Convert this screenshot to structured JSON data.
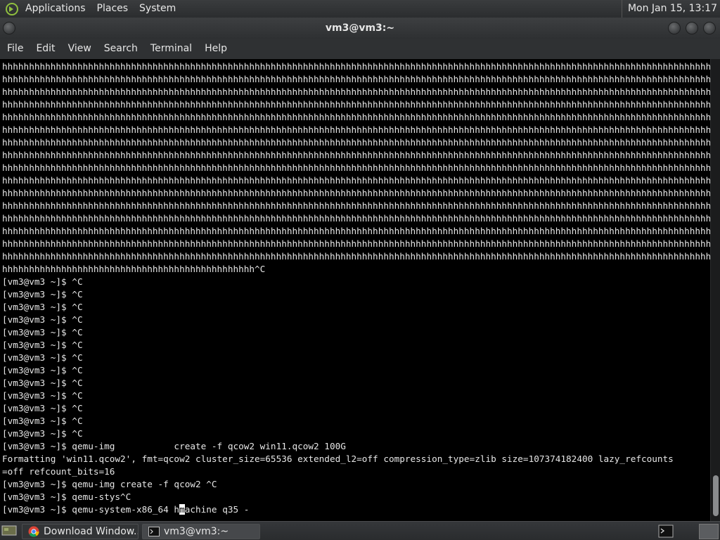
{
  "top_panel": {
    "menus": [
      "Applications",
      "Places",
      "System"
    ],
    "clock": "Mon Jan 15, 13:17"
  },
  "window": {
    "title": "vm3@vm3:~"
  },
  "menubar": [
    "File",
    "Edit",
    "View",
    "Search",
    "Terminal",
    "Help"
  ],
  "terminal": {
    "lines": [
      "hhhhhhhhhhhhhhhhhhhhhhhhhhhhhhhhhhhhhhhhhhhhhhhhhhhhhhhhhhhhhhhhhhhhhhhhhhhhhhhhhhhhhhhhhhhhhhhhhhhhhhhhhhhhhhhhhhhhhhhhhhhhhhhhhhhhhhhhhhhh",
      "hhhhhhhhhhhhhhhhhhhhhhhhhhhhhhhhhhhhhhhhhhhhhhhhhhhhhhhhhhhhhhhhhhhhhhhhhhhhhhhhhhhhhhhhhhhhhhhhhhhhhhhhhhhhhhhhhhhhhhhhhhhhhhhhhhhhhhhhhhhh",
      "hhhhhhhhhhhhhhhhhhhhhhhhhhhhhhhhhhhhhhhhhhhhhhhhhhhhhhhhhhhhhhhhhhhhhhhhhhhhhhhhhhhhhhhhhhhhhhhhhhhhhhhhhhhhhhhhhhhhhhhhhhhhhhhhhhhhhhhhhhhh",
      "hhhhhhhhhhhhhhhhhhhhhhhhhhhhhhhhhhhhhhhhhhhhhhhhhhhhhhhhhhhhhhhhhhhhhhhhhhhhhhhhhhhhhhhhhhhhhhhhhhhhhhhhhhhhhhhhhhhhhhhhhhhhhhhhhhhhhhhhhhhh",
      "hhhhhhhhhhhhhhhhhhhhhhhhhhhhhhhhhhhhhhhhhhhhhhhhhhhhhhhhhhhhhhhhhhhhhhhhhhhhhhhhhhhhhhhhhhhhhhhhhhhhhhhhhhhhhhhhhhhhhhhhhhhhhhhhhhhhhhhhhhhh",
      "hhhhhhhhhhhhhhhhhhhhhhhhhhhhhhhhhhhhhhhhhhhhhhhhhhhhhhhhhhhhhhhhhhhhhhhhhhhhhhhhhhhhhhhhhhhhhhhhhhhhhhhhhhhhhhhhhhhhhhhhhhhhhhhhhhhhhhhhhhhh",
      "hhhhhhhhhhhhhhhhhhhhhhhhhhhhhhhhhhhhhhhhhhhhhhhhhhhhhhhhhhhhhhhhhhhhhhhhhhhhhhhhhhhhhhhhhhhhhhhhhhhhhhhhhhhhhhhhhhhhhhhhhhhhhhhhhhhhhhhhhhhh",
      "hhhhhhhhhhhhhhhhhhhhhhhhhhhhhhhhhhhhhhhhhhhhhhhhhhhhhhhhhhhhhhhhhhhhhhhhhhhhhhhhhhhhhhhhhhhhhhhhhhhhhhhhhhhhhhhhhhhhhhhhhhhhhhhhhhhhhhhhhhhh",
      "hhhhhhhhhhhhhhhhhhhhhhhhhhhhhhhhhhhhhhhhhhhhhhhhhhhhhhhhhhhhhhhhhhhhhhhhhhhhhhhhhhhhhhhhhhhhhhhhhhhhhhhhhhhhhhhhhhhhhhhhhhhhhhhhhhhhhhhhhhhh",
      "hhhhhhhhhhhhhhhhhhhhhhhhhhhhhhhhhhhhhhhhhhhhhhhhhhhhhhhhhhhhhhhhhhhhhhhhhhhhhhhhhhhhhhhhhhhhhhhhhhhhhhhhhhhhhhhhhhhhhhhhhhhhhhhhhhhhhhhhhhhh",
      "hhhhhhhhhhhhhhhhhhhhhhhhhhhhhhhhhhhhhhhhhhhhhhhhhhhhhhhhhhhhhhhhhhhhhhhhhhhhhhhhhhhhhhhhhhhhhhhhhhhhhhhhhhhhhhhhhhhhhhhhhhhhhhhhhhhhhhhhhhhh",
      "hhhhhhhhhhhhhhhhhhhhhhhhhhhhhhhhhhhhhhhhhhhhhhhhhhhhhhhhhhhhhhhhhhhhhhhhhhhhhhhhhhhhhhhhhhhhhhhhhhhhhhhhhhhhhhhhhhhhhhhhhhhhhhhhhhhhhhhhhhhh",
      "hhhhhhhhhhhhhhhhhhhhhhhhhhhhhhhhhhhhhhhhhhhhhhhhhhhhhhhhhhhhhhhhhhhhhhhhhhhhhhhhhhhhhhhhhhhhhhhhhhhhhhhhhhhhhhhhhhhhhhhhhhhhhhhhhhhhhhhhhhhh",
      "hhhhhhhhhhhhhhhhhhhhhhhhhhhhhhhhhhhhhhhhhhhhhhhhhhhhhhhhhhhhhhhhhhhhhhhhhhhhhhhhhhhhhhhhhhhhhhhhhhhhhhhhhhhhhhhhhhhhhhhhhhhhhhhhhhhhhhhhhhhh",
      "hhhhhhhhhhhhhhhhhhhhhhhhhhhhhhhhhhhhhhhhhhhhhhhhhhhhhhhhhhhhhhhhhhhhhhhhhhhhhhhhhhhhhhhhhhhhhhhhhhhhhhhhhhhhhhhhhhhhhhhhhhhhhhhhhhhhhhhhhhhh",
      "hhhhhhhhhhhhhhhhhhhhhhhhhhhhhhhhhhhhhhhhhhhhhhhhhhhhhhhhhhhhhhhhhhhhhhhhhhhhhhhhhhhhhhhhhhhhhhhhhhhhhhhhhhhhhhhhhhhhhhhhhhhhhhhhhhhhhhhhhhhh",
      "hhhhhhhhhhhhhhhhhhhhhhhhhhhhhhhhhhhhhhhhhhhhhhh^C",
      "[vm3@vm3 ~]$ ^C",
      "[vm3@vm3 ~]$ ^C",
      "[vm3@vm3 ~]$ ^C",
      "[vm3@vm3 ~]$ ^C",
      "[vm3@vm3 ~]$ ^C",
      "[vm3@vm3 ~]$ ^C",
      "[vm3@vm3 ~]$ ^C",
      "[vm3@vm3 ~]$ ^C",
      "[vm3@vm3 ~]$ ^C",
      "[vm3@vm3 ~]$ ^C",
      "[vm3@vm3 ~]$ ^C",
      "[vm3@vm3 ~]$ ^C",
      "[vm3@vm3 ~]$ ^C",
      "[vm3@vm3 ~]$ qemu-img           create -f qcow2 win11.qcow2 100G",
      "Formatting 'win11.qcow2', fmt=qcow2 cluster_size=65536 extended_l2=off compression_type=zlib size=107374182400 lazy_refcounts",
      "=off refcount_bits=16",
      "[vm3@vm3 ~]$ qemu-img create -f qcow2 ^C",
      "[vm3@vm3 ~]$ qemu-stys^C"
    ],
    "prompt_line": {
      "before_cursor": "[vm3@vm3 ~]$ qemu-system-x86_64 h",
      "cursor_char": "m",
      "after_cursor": "achine q35 -"
    }
  },
  "taskbar": {
    "tasks": [
      {
        "label": "Download Window...",
        "icon": "chrome-icon"
      },
      {
        "label": "vm3@vm3:~",
        "icon": "terminal-icon"
      }
    ]
  }
}
